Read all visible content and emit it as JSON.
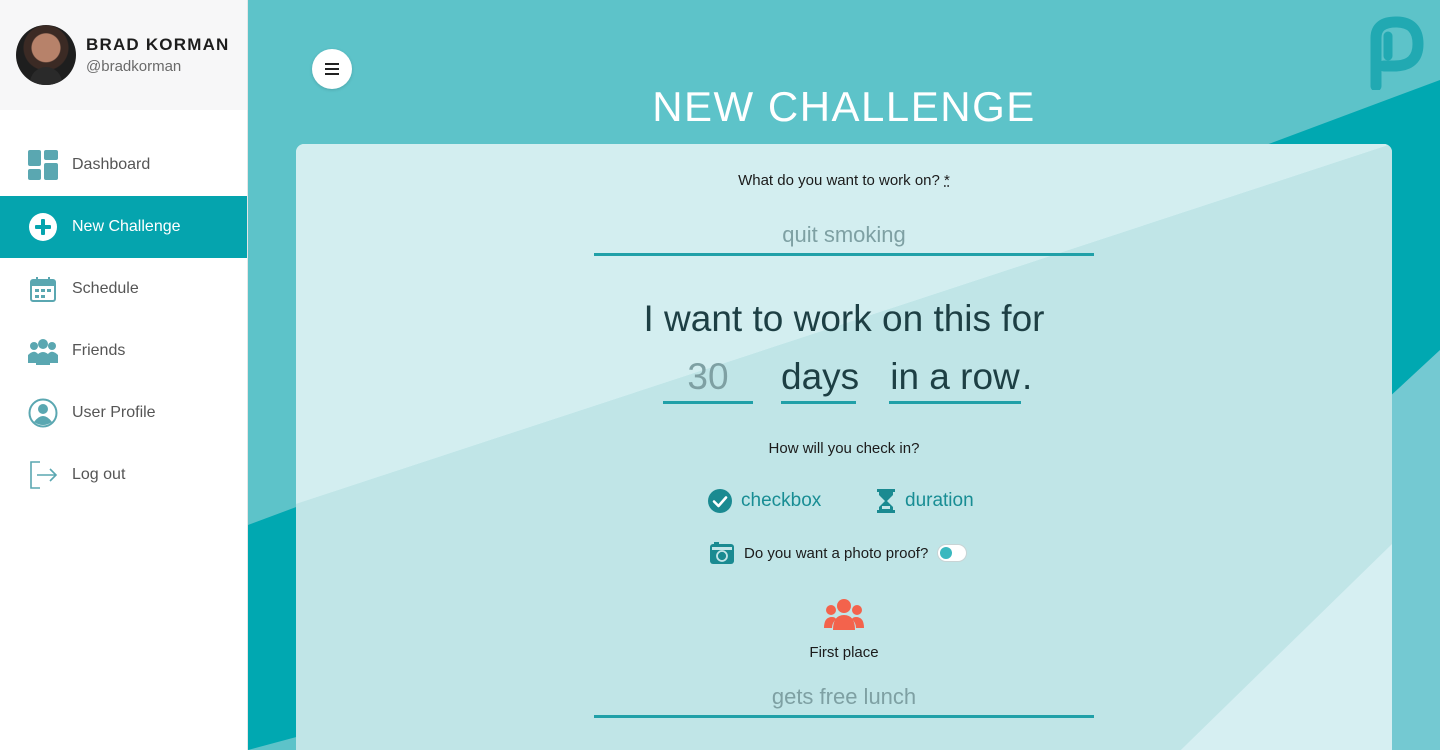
{
  "profile": {
    "name": "BRAD KORMAN",
    "handle": "@bradkorman"
  },
  "nav": [
    {
      "label": "Dashboard",
      "icon": "dashboard-grid-icon",
      "active": false
    },
    {
      "label": "New Challenge",
      "icon": "plus-circle-icon",
      "active": true
    },
    {
      "label": "Schedule",
      "icon": "calendar-icon",
      "active": false
    },
    {
      "label": "Friends",
      "icon": "people-group-icon",
      "active": false
    },
    {
      "label": "User Profile",
      "icon": "user-circle-icon",
      "active": false
    },
    {
      "label": "Log out",
      "icon": "logout-arrow-icon",
      "active": false
    }
  ],
  "page": {
    "title": "NEW CHALLENGE"
  },
  "form": {
    "goal_label": "What do you want to work on?",
    "goal_required_mark": "*",
    "goal_placeholder": "quit smoking",
    "duration_sentence": "I want to work on this for",
    "duration_placeholder": "30",
    "duration_unit": "days",
    "duration_mode": "in a row",
    "duration_period": ".",
    "checkin_label": "How will you check in?",
    "checkin_options": [
      {
        "label": "checkbox",
        "icon": "check-circle-icon"
      },
      {
        "label": "duration",
        "icon": "hourglass-icon"
      }
    ],
    "photo_label": "Do you want a photo proof?",
    "photo_enabled": false,
    "first_place_label": "First place",
    "prize_placeholder": "gets free lunch"
  },
  "colors": {
    "accent": "#05a4ae",
    "background_teal": "#5dc3c9",
    "prize_icon": "#f3634c"
  }
}
